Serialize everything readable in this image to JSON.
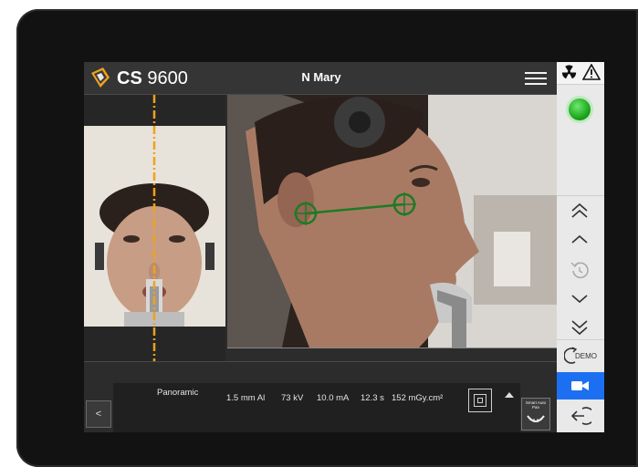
{
  "header": {
    "brand_bold": "CS",
    "brand_model": "9600",
    "patient_name": "N Mary"
  },
  "exposure": {
    "program": "Panoramic",
    "filter": "1.5 mm Al",
    "voltage": "73 kV",
    "current": "10.0 mA",
    "time": "12.3 s",
    "dose": "152 mGy.cm²"
  },
  "controls": {
    "back_label": "<",
    "demo_label": "DEMO",
    "smart_auto_pan_label": "Smart Auto Pan"
  },
  "colors": {
    "alignment_line": "#f0a21a",
    "crosshair": "#1e7a26",
    "active_button": "#1d6ff2",
    "ready_indicator": "#22b022"
  },
  "icons": {
    "logo": "cs-logo-icon",
    "menu": "hamburger-menu-icon",
    "radiation": "radiation-icon",
    "warning": "warning-icon",
    "ready": "ready-light-icon",
    "up_fast": "double-chevron-up-icon",
    "up": "chevron-up-icon",
    "reset": "reset-position-icon",
    "down": "chevron-down-icon",
    "down_fast": "double-chevron-down-icon",
    "demo": "demo-icon",
    "camera": "video-camera-icon",
    "exit": "exit-icon",
    "panoramic": "panoramic-mode-icon"
  }
}
